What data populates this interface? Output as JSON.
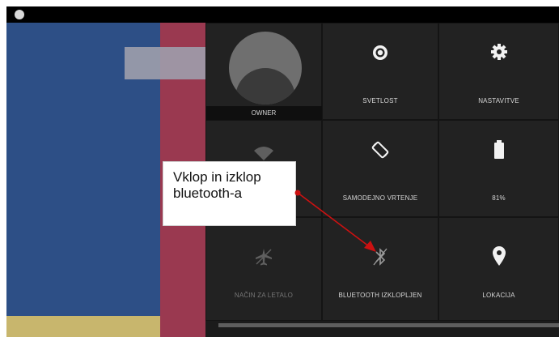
{
  "tiles": {
    "owner": {
      "label": "OWNER"
    },
    "brightness": {
      "label": "SVETLOST",
      "icon": "brightness-icon"
    },
    "settings": {
      "label": "NASTAVITVE",
      "icon": "gear-icon"
    },
    "wifi": {
      "label": "",
      "icon": "wifi-icon"
    },
    "rotation": {
      "label": "SAMODEJNO VRTENJE",
      "icon": "rotate-icon"
    },
    "battery": {
      "label": "81%",
      "icon": "battery-icon"
    },
    "airplane": {
      "label": "NAČIN ZA LETALO",
      "icon": "airplane-icon"
    },
    "bluetooth": {
      "label": "BLUETOOTH IZKLOPLJEN",
      "icon": "bluetooth-off-icon"
    },
    "location": {
      "label": "LOKACIJA",
      "icon": "location-pin-icon"
    }
  },
  "callout": {
    "line1": "Vklop in izklop",
    "line2": "bluetooth-a"
  },
  "colors": {
    "panel": "#1b1b1b",
    "tile": "#222222",
    "arrow": "#cc1111",
    "wallpaper_blue": "#2d4f86",
    "wallpaper_red": "#9a3950"
  }
}
